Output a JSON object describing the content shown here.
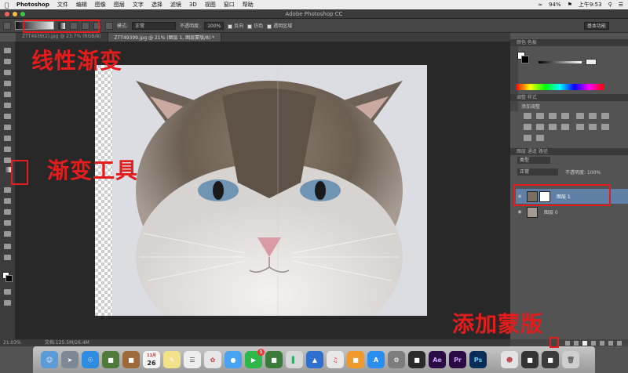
{
  "menubar": {
    "app": "Photoshop",
    "items": [
      "文件",
      "编辑",
      "图像",
      "图层",
      "文字",
      "选择",
      "滤镜",
      "3D",
      "视图",
      "窗口",
      "帮助"
    ],
    "battery": "94%",
    "time": "上午9:53"
  },
  "window": {
    "title": "Adobe Photoshop CC"
  },
  "options": {
    "mode_label": "模式:",
    "mode_value": "正常",
    "opacity_label": "不透明度:",
    "opacity_value": "100%",
    "reverse": "反向",
    "dither": "仿色",
    "transparency": "透明区域",
    "workspace": "基本功能"
  },
  "tabs": [
    {
      "label": "ZTT4939(2).jpg @ 23.7% (RGB/8)"
    },
    {
      "label": "ZTT49399.jpg @ 21% (图层 1, 图层蒙版/8) *"
    }
  ],
  "panels": {
    "color_tabs": "颜色  色板",
    "adjust_tabs": "调整  样式",
    "adjust_title": "添加调整",
    "layers_tabs": "图层  通道  路径",
    "kind_filter": "类型",
    "blend_mode": "正常",
    "opacity": "不透明度: 100%",
    "layer1": "图层 1",
    "layer0": "图层 0"
  },
  "status": {
    "zoom": "21.03%",
    "doc": "文档:125.5M/26.4M"
  },
  "annotations": {
    "linear_gradient": "线性渐变",
    "gradient_tool": "渐变工具",
    "add_mask": "添加蒙版"
  },
  "dock": {
    "calendar_month": "11月",
    "calendar_day": "26",
    "badge": "1",
    "ae": "Ae",
    "pr": "Pr",
    "ps": "Ps"
  },
  "colors": {
    "annotation": "#e21d1d",
    "selected_layer": "#5f7fa6",
    "ps_blue": "#0a2d55",
    "ae_purple": "#2a0b44"
  }
}
